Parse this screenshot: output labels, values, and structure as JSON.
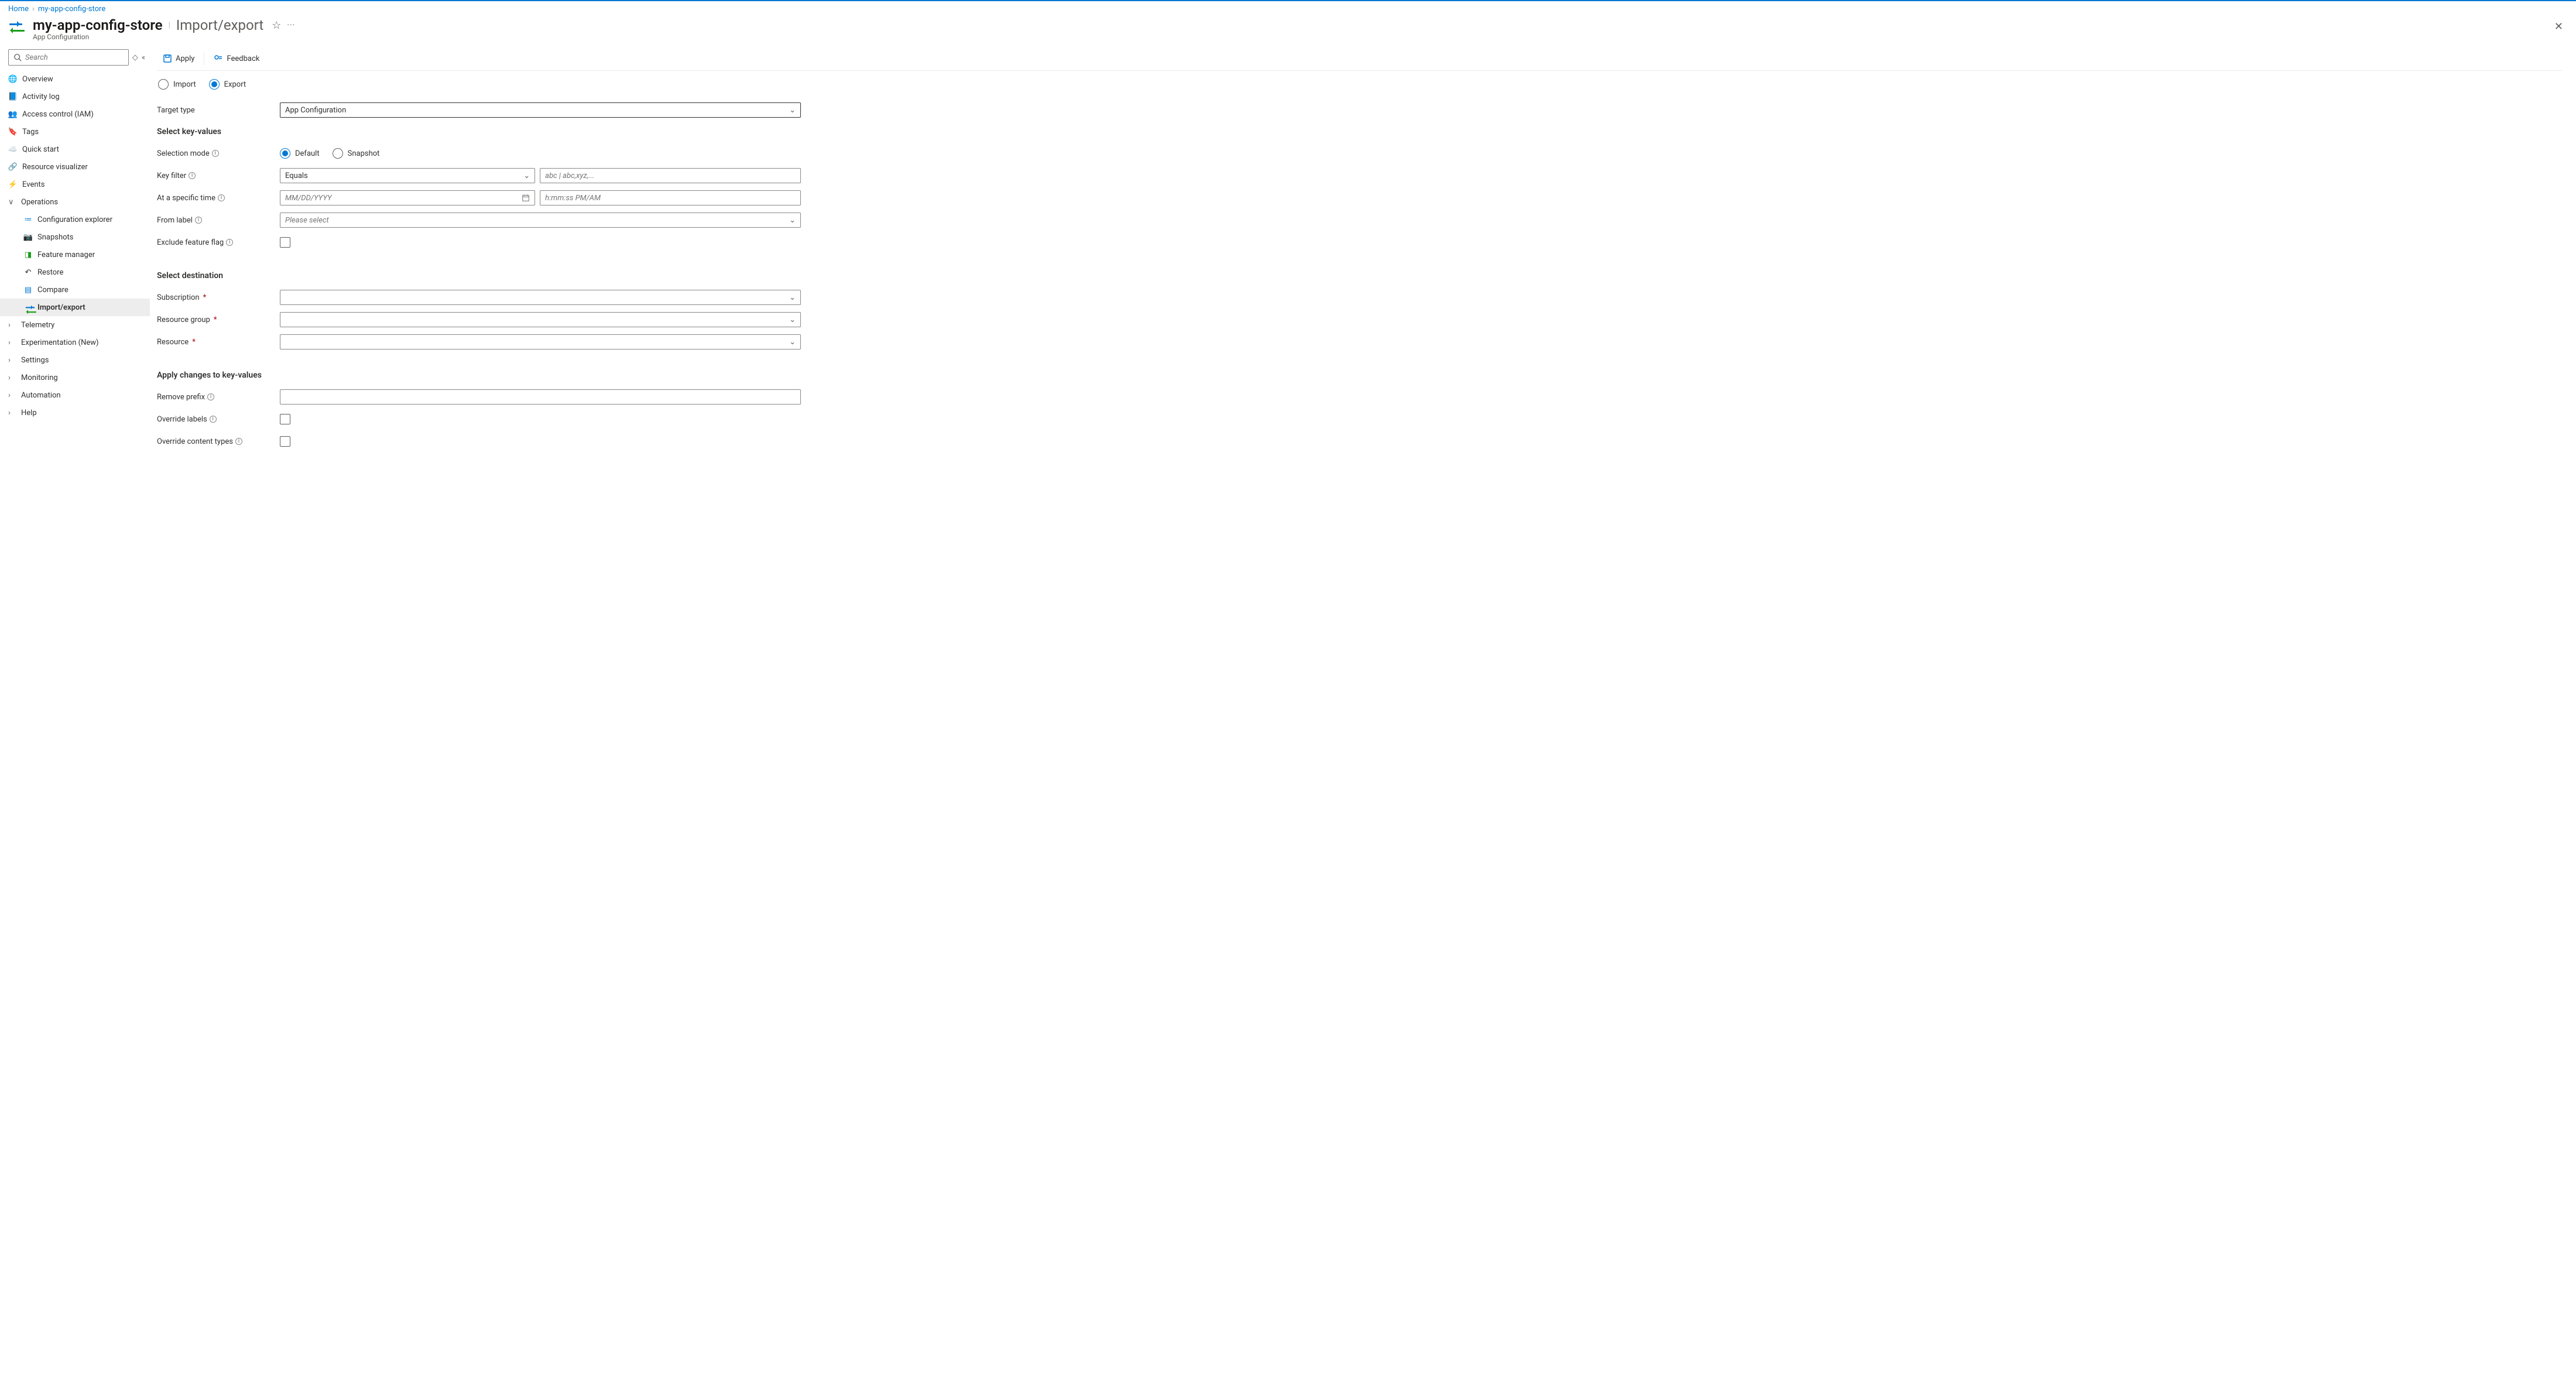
{
  "breadcrumbs": [
    "Home",
    "my-app-config-store"
  ],
  "header": {
    "title": "my-app-config-store",
    "section": "Import/export",
    "subtitle": "App Configuration"
  },
  "sidebar": {
    "search_placeholder": "Search",
    "items": [
      {
        "label": "Overview",
        "icon": "globe"
      },
      {
        "label": "Activity log",
        "icon": "log"
      },
      {
        "label": "Access control (IAM)",
        "icon": "people"
      },
      {
        "label": "Tags",
        "icon": "tag"
      },
      {
        "label": "Quick start",
        "icon": "cloud"
      },
      {
        "label": "Resource visualizer",
        "icon": "nodes"
      },
      {
        "label": "Events",
        "icon": "bolt"
      }
    ],
    "operations_label": "Operations",
    "operations": [
      {
        "label": "Configuration explorer",
        "icon": "list"
      },
      {
        "label": "Snapshots",
        "icon": "camera"
      },
      {
        "label": "Feature manager",
        "icon": "toggle"
      },
      {
        "label": "Restore",
        "icon": "undo"
      },
      {
        "label": "Compare",
        "icon": "compare"
      },
      {
        "label": "Import/export",
        "icon": "swap",
        "selected": true
      }
    ],
    "collapsed": [
      "Telemetry",
      "Experimentation (New)",
      "Settings",
      "Monitoring",
      "Automation",
      "Help"
    ]
  },
  "commandbar": {
    "apply": "Apply",
    "feedback": "Feedback"
  },
  "mode": {
    "import": "Import",
    "export": "Export"
  },
  "form": {
    "target_type_label": "Target type",
    "target_type_value": "App Configuration",
    "select_kv_head": "Select key-values",
    "selection_mode_label": "Selection mode",
    "selection_mode": {
      "default": "Default",
      "snapshot": "Snapshot"
    },
    "key_filter_label": "Key filter",
    "key_filter_value": "Equals",
    "key_filter_text_ph": "abc | abc,xyz,...",
    "time_label": "At a specific time",
    "date_ph": "MM/DD/YYYY",
    "time_ph": "h:mm:ss PM/AM",
    "from_label_label": "From label",
    "from_label_ph": "Please select",
    "exclude_ff_label": "Exclude feature flag",
    "dest_head": "Select destination",
    "subscription_label": "Subscription",
    "rg_label": "Resource group",
    "resource_label": "Resource",
    "apply_head": "Apply changes to key-values",
    "remove_prefix_label": "Remove prefix",
    "override_labels_label": "Override labels",
    "override_ct_label": "Override content types"
  }
}
